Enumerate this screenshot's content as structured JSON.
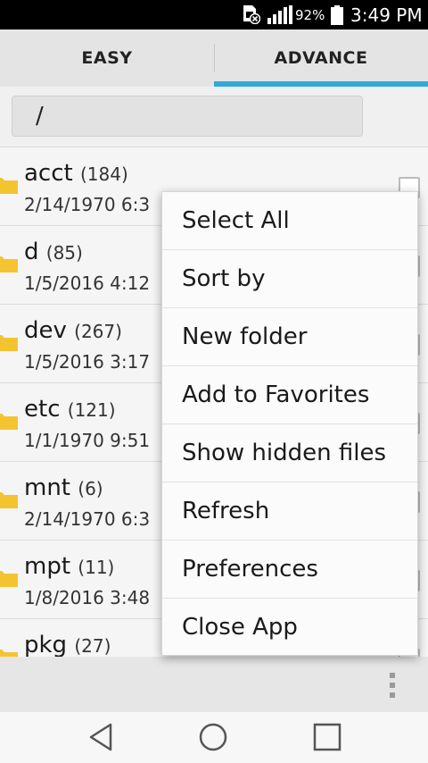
{
  "status_bar": {
    "battery_percent": "92%",
    "time": "3:49 PM",
    "icons": [
      "sim-error-icon",
      "signal-icon",
      "battery-icon"
    ]
  },
  "tabs": [
    {
      "label": "EASY",
      "selected": false
    },
    {
      "label": "ADVANCE",
      "selected": true
    }
  ],
  "path": {
    "value": "/"
  },
  "files": [
    {
      "name": "acct",
      "count": "(184)",
      "date": "2/14/1970 6:3"
    },
    {
      "name": "d",
      "count": "(85)",
      "date": "1/5/2016 4:12"
    },
    {
      "name": "dev",
      "count": "(267)",
      "date": "1/5/2016 3:17"
    },
    {
      "name": "etc",
      "count": "(121)",
      "date": "1/1/1970 9:51"
    },
    {
      "name": "mnt",
      "count": "(6)",
      "date": "2/14/1970 6:3"
    },
    {
      "name": "mpt",
      "count": "(11)",
      "date": "1/8/2016 3:48"
    },
    {
      "name": "pkg",
      "count": "(27)",
      "date": ""
    }
  ],
  "menu": {
    "items": [
      "Select All",
      "Sort by",
      "New folder",
      "Add to Favorites",
      "Show hidden files",
      "Refresh",
      "Preferences",
      "Close App"
    ]
  },
  "colors": {
    "accent": "#33a8d8",
    "folder": "#f4c430"
  }
}
